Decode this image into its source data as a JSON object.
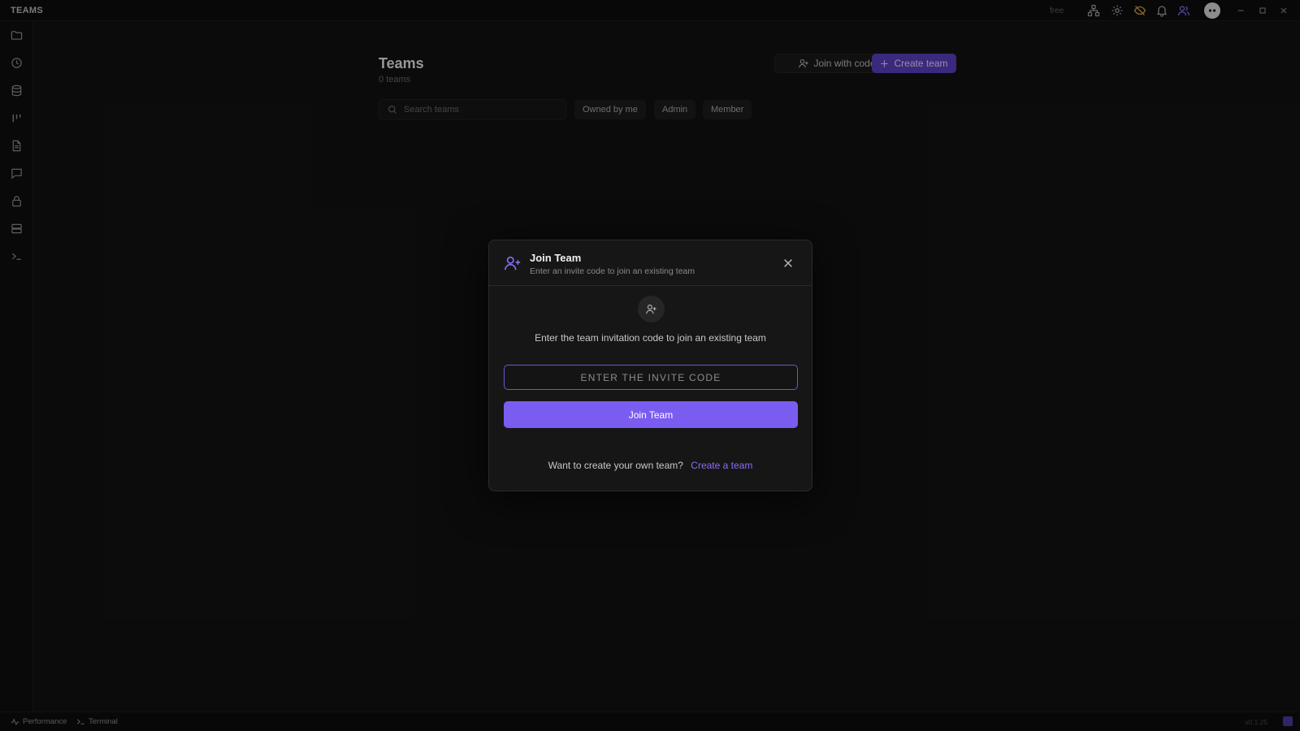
{
  "titlebar": {
    "app_title": "TEAMS",
    "plan_badge": "free",
    "icons": [
      "network-icon",
      "gear-icon",
      "eye-off-icon",
      "bell-icon",
      "users-icon",
      "avatar"
    ],
    "window_controls": [
      "minimize-icon",
      "maximize-icon",
      "close-icon"
    ]
  },
  "sidebar": {
    "items": [
      "folder-icon",
      "clock-icon",
      "database-icon",
      "kanban-icon",
      "document-icon",
      "chat-icon",
      "lock-icon",
      "server-icon",
      "terminal-icon"
    ]
  },
  "main": {
    "title": "Teams",
    "count": "0 teams",
    "join_with_code_label": "Join with code",
    "create_team_label": "Create team",
    "search": {
      "placeholder": "Search teams",
      "value": ""
    },
    "filters": [
      "Owned by me",
      "Admin",
      "Member"
    ]
  },
  "dialog": {
    "title": "Join Team",
    "subtitle": "Enter an invite code to join an existing team",
    "description": "Enter the team invitation code to join an existing team",
    "input_placeholder": "ENTER THE INVITE CODE",
    "input_value": "",
    "join_button_label": "Join Team",
    "footer_text": "Want to create your own team?",
    "footer_link": "Create a team"
  },
  "statusbar": {
    "performance_label": "Performance",
    "terminal_label": "Terminal",
    "version": "v0.1.25"
  },
  "colors": {
    "accent": "#7b5cf0",
    "accent_dark": "#5a3fc0",
    "background": "#121212",
    "dialog_background": "#161616"
  }
}
